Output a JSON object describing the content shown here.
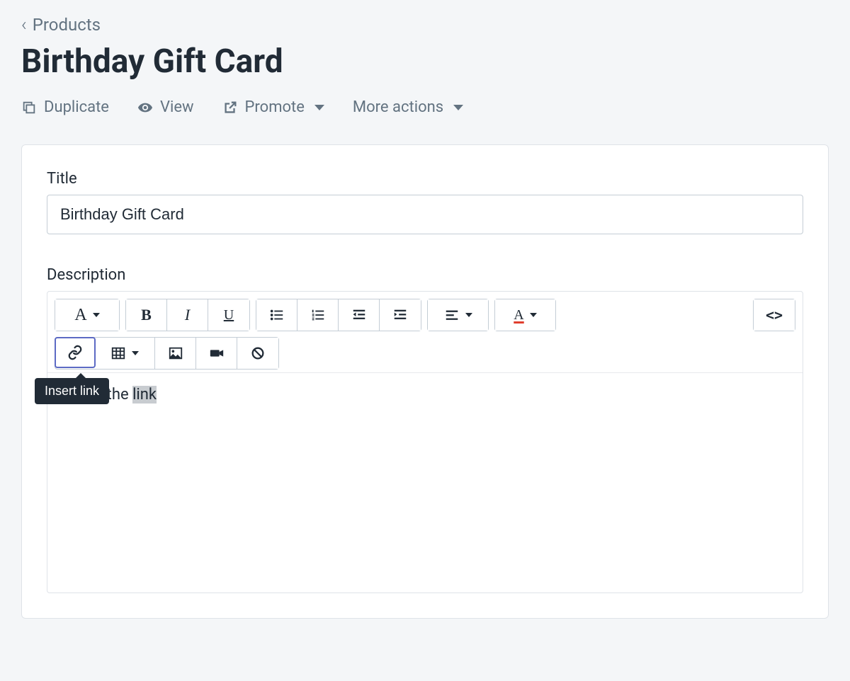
{
  "breadcrumb": {
    "label": "Products"
  },
  "page": {
    "title": "Birthday Gift Card"
  },
  "actions": {
    "duplicate": "Duplicate",
    "view": "View",
    "promote": "Promote",
    "more_actions": "More actions"
  },
  "form": {
    "title_label": "Title",
    "title_value": "Birthday Gift Card",
    "description_label": "Description"
  },
  "editor": {
    "content_prefix": "this is the ",
    "content_selected": "link",
    "tooltip_insert_link": "Insert link",
    "format_letter": "A",
    "bold_letter": "B",
    "italic_letter": "I",
    "underline_letter": "U",
    "textcolor_letter": "A",
    "code_symbol": "<>"
  }
}
